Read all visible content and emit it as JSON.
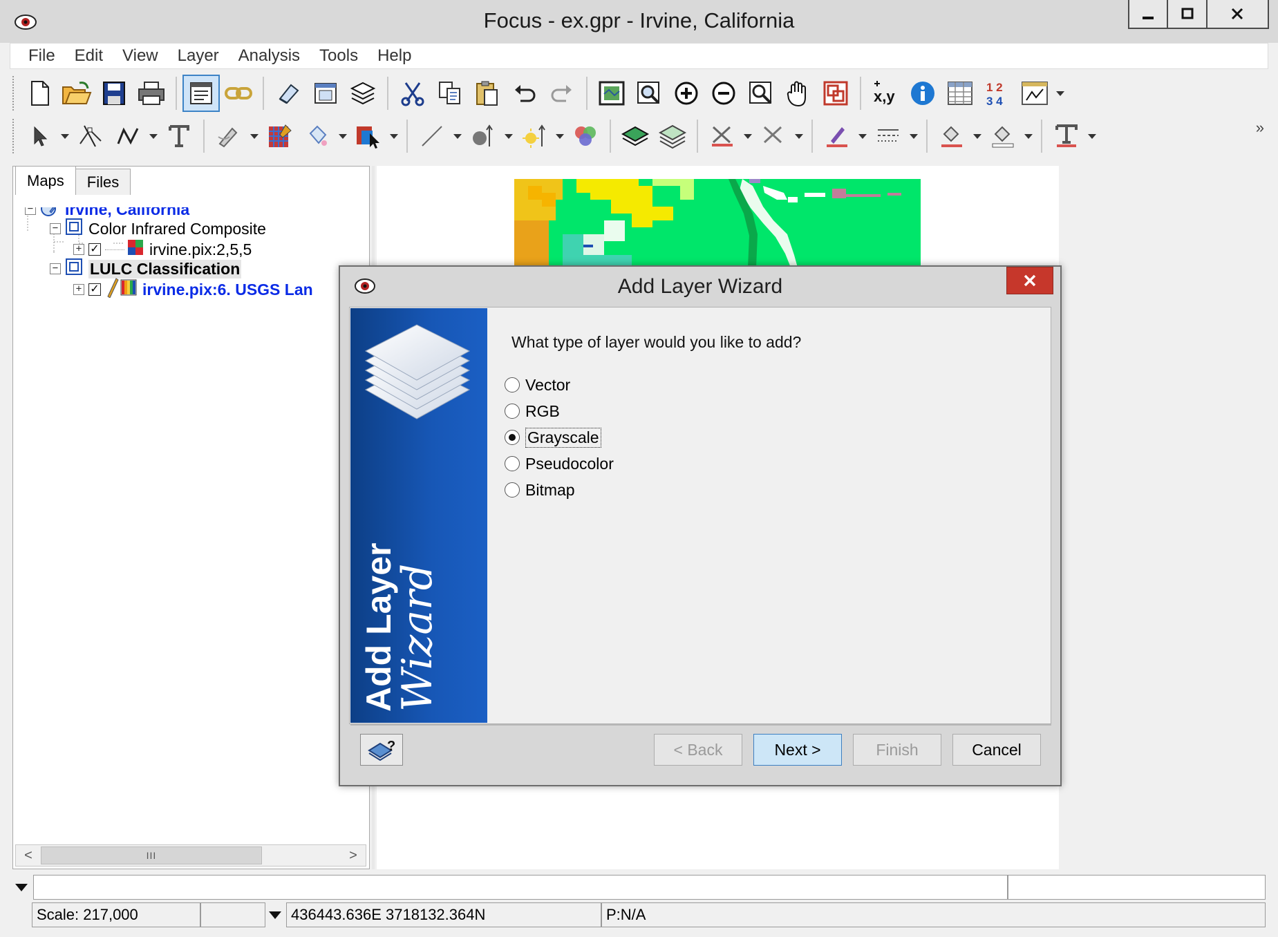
{
  "window": {
    "title": "Focus - ex.gpr - Irvine, California",
    "controls": [
      "minimize",
      "maximize",
      "close"
    ]
  },
  "menu": [
    "File",
    "Edit",
    "View",
    "Layer",
    "Analysis",
    "Tools",
    "Help"
  ],
  "toolbar": {
    "row1_icons": [
      "new-file-icon",
      "open-folder-icon",
      "save-icon",
      "print-icon",
      "properties-icon",
      "link-icon",
      "eraser-icon",
      "window-icon",
      "layers-icon",
      "cut-icon",
      "copy-icon",
      "paste-icon",
      "undo-icon",
      "redo-icon",
      "zoom-extent-icon",
      "zoom-select-icon",
      "zoom-in-icon",
      "zoom-out-icon",
      "zoom-window-icon",
      "pan-hand-icon",
      "overview-icon",
      "xy-coordinate-icon",
      "info-icon",
      "table-icon",
      "numbering-icon",
      "chart-dropdown-icon"
    ],
    "xy_label": "x,y",
    "num_label_top": "1 2",
    "num_label_bottom": "3 4",
    "more_label": "»"
  },
  "left_panel": {
    "tabs": [
      "Maps",
      "Files"
    ],
    "selected_tab": "Maps",
    "tree": [
      {
        "label": "Irvine, California",
        "level": 0,
        "style": "link"
      },
      {
        "label": "Color Infrared Composite",
        "level": 1,
        "style": "normal"
      },
      {
        "label": "irvine.pix:2,5,5",
        "level": 2,
        "style": "normal",
        "checked": true
      },
      {
        "label": "LULC Classification",
        "level": 1,
        "style": "bold"
      },
      {
        "label": "irvine.pix:6. USGS Lan",
        "level": 2,
        "style": "link",
        "checked": true
      }
    ],
    "scroll_thumb": "III"
  },
  "dialog": {
    "title": "Add Layer Wizard",
    "banner_line1": "Add Layer",
    "banner_line2": "Wizard",
    "question": "What type of layer would you like to add?",
    "options": [
      "Vector",
      "RGB",
      "Grayscale",
      "Pseudocolor",
      "Bitmap"
    ],
    "selected_option": "Grayscale",
    "buttons": {
      "back": "< Back",
      "next": "Next >",
      "finish": "Finish",
      "cancel": "Cancel"
    },
    "close_label": "✕"
  },
  "status": {
    "scale": "Scale: 217,000",
    "coordinates": "436443.636E 3718132.364N",
    "projection": "P:N/A"
  },
  "colors": {
    "accent": "#3c83c6",
    "link": "#0a2be6",
    "banner": "#1757b6",
    "close_button": "#c6372b"
  }
}
